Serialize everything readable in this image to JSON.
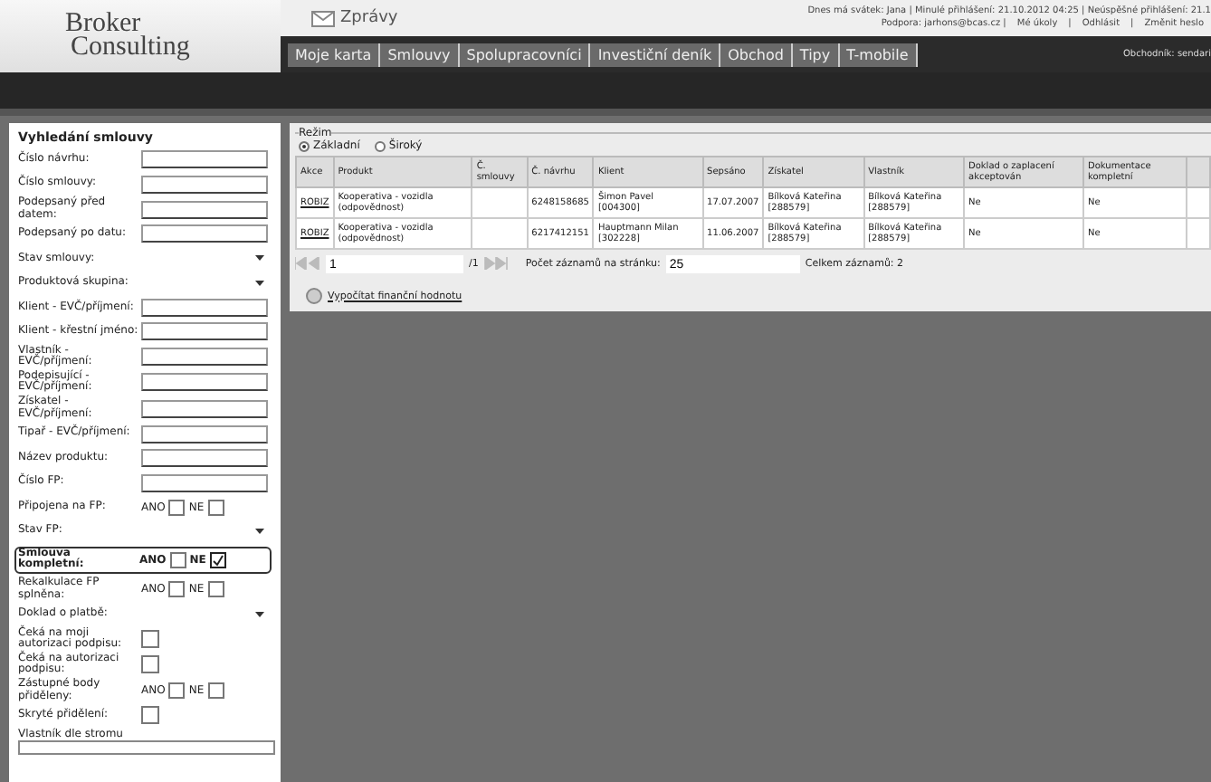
{
  "header": {
    "logo_top": "Broker",
    "logo_bottom": "Consulting",
    "messages": "Zprávy",
    "info_line": "Dnes má svátek: Jana | Minulé přihlášení: 21.10.2012 04:25 | Neúspěšné přihlášení: 21.1",
    "links": [
      "Podpora: jarhons@bcas.cz |",
      "Mé úkoly",
      "|",
      "Odhlásit",
      "|",
      "Změnit heslo"
    ],
    "user": "Obchodník: sendari"
  },
  "nav": [
    {
      "label": "Moje karta"
    },
    {
      "label": "Smlouvy"
    },
    {
      "label": "Spolupracovníci"
    },
    {
      "label": "Investiční deník"
    },
    {
      "label": "Obchod"
    },
    {
      "label": "Tipy"
    },
    {
      "label": "T-mobile"
    }
  ],
  "search": {
    "title": "Vyhledání smlouvy",
    "fields": [
      {
        "label": "Číslo návrhu:",
        "kind": "text"
      },
      {
        "label": "Číslo smlouvy:",
        "kind": "text"
      },
      {
        "label": "Podepsaný před datem:",
        "kind": "text"
      },
      {
        "label": "Podepsaný po datu:",
        "kind": "text"
      },
      {
        "label": "Stav smlouvy:",
        "kind": "select"
      },
      {
        "label": "Produktová skupina:",
        "kind": "select"
      },
      {
        "label": "Klient - EVČ/příjmení:",
        "kind": "text"
      },
      {
        "label": "Klient - křestní jméno:",
        "kind": "text"
      },
      {
        "label": "Vlastník - EVČ/příjmení:",
        "kind": "text"
      },
      {
        "label": "Podepisující - EVČ/příjmení:",
        "kind": "text"
      },
      {
        "label": "Získatel - EVČ/příjmení:",
        "kind": "text"
      },
      {
        "label": "Tipař - EVČ/příjmení:",
        "kind": "text"
      },
      {
        "label": "Název produktu:",
        "kind": "text"
      },
      {
        "label": "Číslo FP:",
        "kind": "text"
      },
      {
        "label": "Připojena na FP:",
        "kind": "yesno",
        "yes_label": "ANO",
        "no_label": "NE",
        "yes": false,
        "no": false
      },
      {
        "label": "Stav FP:",
        "kind": "select"
      },
      {
        "label": "Smlouva kompletní:",
        "kind": "yesno",
        "yes_label": "ANO",
        "no_label": "NE",
        "yes": false,
        "no": true,
        "highlighted": true
      },
      {
        "label": "Rekalkulace FP splněna:",
        "kind": "yesno",
        "yes_label": "ANO",
        "no_label": "NE",
        "yes": false,
        "no": false
      },
      {
        "label": "Doklad o platbě:",
        "kind": "select"
      },
      {
        "label": "Čeká na moji autorizaci podpisu:",
        "kind": "check",
        "checked": false
      },
      {
        "label": "Čeká na autorizaci podpisu:",
        "kind": "check",
        "checked": false
      },
      {
        "label": "Zástupné body přiděleny:",
        "kind": "yesno",
        "yes_label": "ANO",
        "no_label": "NE",
        "yes": false,
        "no": false
      },
      {
        "label": "Skryté přidělení:",
        "kind": "check",
        "checked": false
      },
      {
        "label": "Vlastník dle stromu",
        "kind": "wide"
      }
    ]
  },
  "results": {
    "mode_title": "Režim",
    "modes": [
      {
        "label": "Základní",
        "selected": true
      },
      {
        "label": "Široký",
        "selected": false
      }
    ],
    "columns": [
      "Akce",
      "Produkt",
      "Č. smlouvy",
      "Č. návrhu",
      "Klient",
      "Sepsáno",
      "Získatel",
      "Vlastník",
      "Doklad o zaplacení akceptován",
      "Dokumentace kompletní"
    ],
    "rows": [
      [
        "ROBIZ",
        "Kooperativa - vozidla (odpovědnost)",
        "",
        "6248158685",
        "Šimon Pavel [004300]",
        "17.07.2007",
        "Bílková Kateřina [288579]",
        "Bílková Kateřina [288579]",
        "Ne",
        "Ne"
      ],
      [
        "ROBIZ",
        "Kooperativa - vozidla (odpovědnost)",
        "",
        "6217412151",
        "Hauptmann Milan [302228]",
        "11.06.2007",
        "Bílková Kateřina [288579]",
        "Bílková Kateřina [288579]",
        "Ne",
        "Ne"
      ]
    ],
    "page": "1",
    "page_total": "/1",
    "per_page_label": "Počet záznamů na stránku:",
    "per_page": "25",
    "total": "Celkem záznamů: 2",
    "compute_link": "Vypočítat finanční hodnotu"
  }
}
